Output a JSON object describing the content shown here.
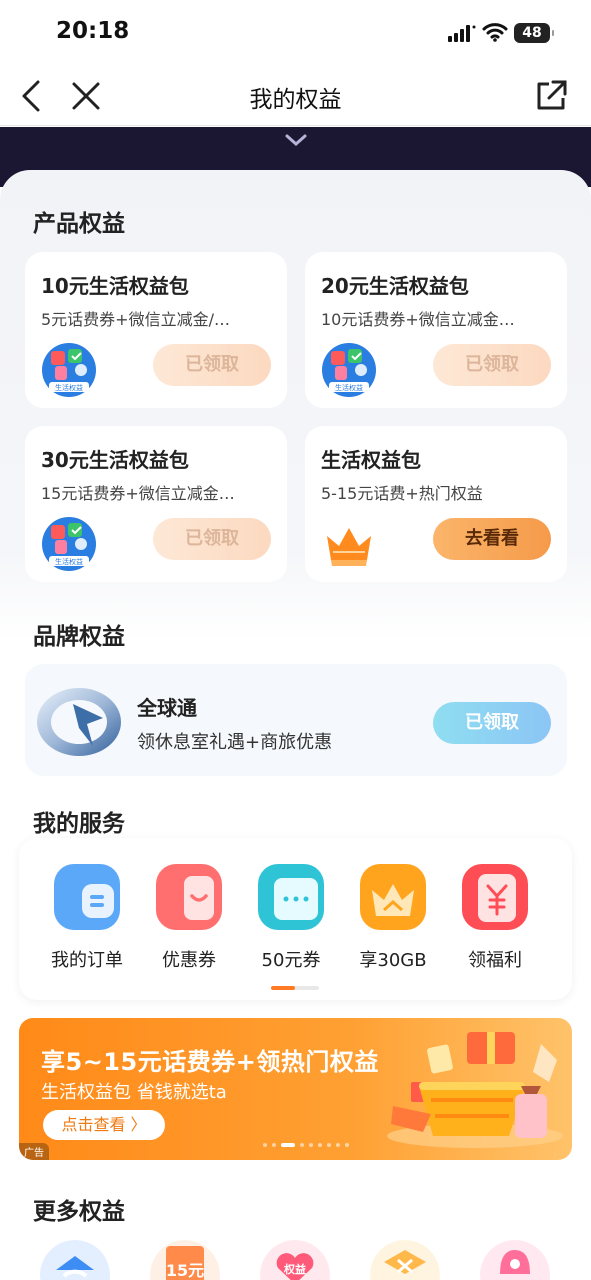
{
  "status_bar": {
    "time": "20:18",
    "battery": "48"
  },
  "nav": {
    "title": "我的权益"
  },
  "sections": {
    "product": "产品权益",
    "brand": "品牌权益",
    "services": "我的服务",
    "more": "更多权益"
  },
  "product_cards": [
    {
      "title": "10元生活权益包",
      "desc": "5元话费券+微信立减金/…",
      "icon_label": "生活权益",
      "button": "已领取",
      "state": "claimed"
    },
    {
      "title": "20元生活权益包",
      "desc": "10元话费券+微信立减金…",
      "icon_label": "生活权益",
      "button": "已领取",
      "state": "claimed"
    },
    {
      "title": "30元生活权益包",
      "desc": "15元话费券+微信立减金…",
      "icon_label": "生活权益",
      "button": "已领取",
      "state": "claimed"
    },
    {
      "title": "生活权益包",
      "desc": "5-15元话费+热门权益",
      "icon": "crown-icon",
      "button": "去看看",
      "state": "active"
    }
  ],
  "brand_card": {
    "name": "全球通",
    "desc": "领休息室礼遇+商旅优惠",
    "button": "已领取"
  },
  "services": [
    {
      "label": "我的订单",
      "icon": "order-icon"
    },
    {
      "label": "优惠券",
      "icon": "coupon-icon"
    },
    {
      "label": "50元券",
      "icon": "ticket-icon"
    },
    {
      "label": "享30GB",
      "icon": "crown-icon"
    },
    {
      "label": "领福利",
      "icon": "red-envelope-icon"
    }
  ],
  "banner": {
    "title": "享5~15元话费券+领热门权益",
    "subtitle": "生活权益包 省钱就选ta",
    "button": "点击查看 〉",
    "ad_tag": "广告",
    "page_count": 9,
    "active_page": 3
  },
  "more_icon_labels": [
    "权益",
    "15元"
  ],
  "colors": {
    "accent_orange": "#F59A4A",
    "dark_band": "#1B1733",
    "brand_blue": "#8CC5F5"
  }
}
